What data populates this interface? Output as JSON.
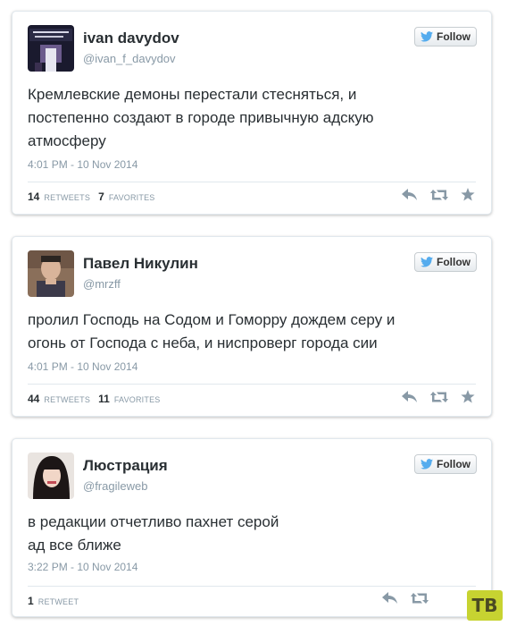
{
  "tweets": [
    {
      "name": "ivan davydov",
      "handle": "@ivan_f_davydov",
      "follow_label": "Follow",
      "text_lines": [
        "Кремлевские демоны перестали стесняться, и",
        "постепенно создают в городе привычную адскую",
        "атмосферу"
      ],
      "time": "4:01 PM - 10 Nov 2014",
      "retweets_count": "14",
      "retweets_label": "RETWEETS",
      "favorites_count": "7",
      "favorites_label": "FAVORITES"
    },
    {
      "name": "Павел Никулин",
      "handle": "@mrzff",
      "follow_label": "Follow",
      "text_lines": [
        "пролил Господь на Содом и Гоморру дождем серу и",
        "огонь от Господа с неба, и ниспроверг города сии"
      ],
      "time": "4:01 PM - 10 Nov 2014",
      "retweets_count": "44",
      "retweets_label": "RETWEETS",
      "favorites_count": "11",
      "favorites_label": "FAVORITES"
    },
    {
      "name": "Люстрация",
      "handle": "@fragileweb",
      "follow_label": "Follow",
      "text_lines": [
        "в редакции отчетливо пахнет серой",
        "ад все ближе"
      ],
      "time": "3:22 PM - 10 Nov 2014",
      "retweets_count": "1",
      "retweets_label": "RETWEET"
    }
  ],
  "watermark": "ТВ",
  "colors": {
    "text": "#292f33",
    "muted": "#8899a6",
    "twitter_blue": "#55acee",
    "border": "#e1e8ed",
    "watermark_bg": "#c7d331"
  },
  "icons": [
    "twitter-bird-icon",
    "reply-icon",
    "retweet-icon",
    "favorite-star-icon"
  ]
}
